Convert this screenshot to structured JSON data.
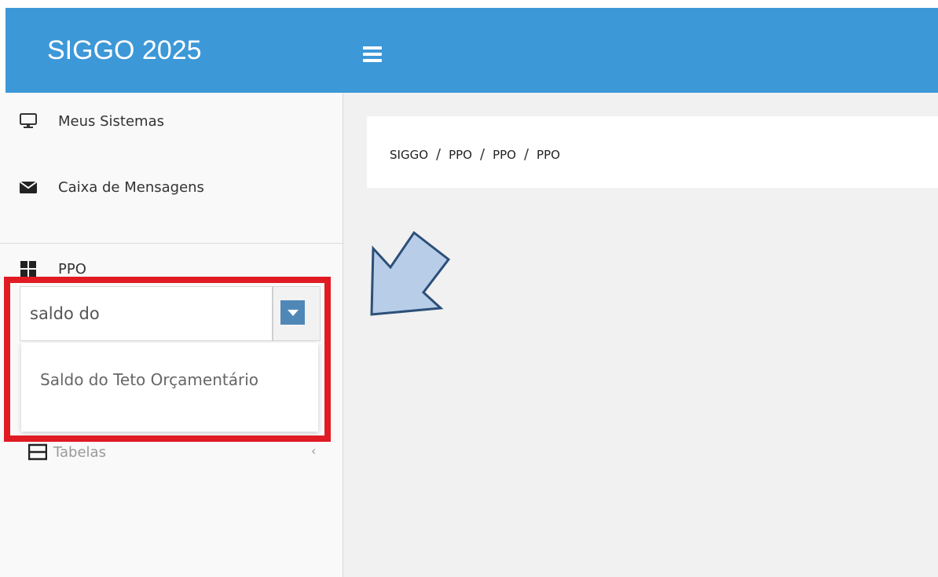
{
  "header": {
    "brand": "SIGGO 2025",
    "menu_icon": "hamburger-icon",
    "background": "#3d98d8"
  },
  "breadcrumb": [
    "SIGGO",
    "PPO",
    "PPO",
    "PPO"
  ],
  "sidebar": {
    "items": [
      {
        "label": "Meus Sistemas",
        "icon": "monitor-icon"
      },
      {
        "label": "Caixa de Mensagens",
        "icon": "envelope-icon"
      },
      {
        "label": "PPO",
        "icon": "grid-icon"
      },
      {
        "label": "Tabelas",
        "icon": "table-icon"
      }
    ],
    "search": {
      "value": "saldo do",
      "results": [
        "Saldo do Teto Orçamentário"
      ]
    }
  },
  "colors": {
    "highlight_box": "#e01b24",
    "arrow_fill": "#b7cde8",
    "arrow_stroke": "#2c4f78",
    "search_button": "#4f88b6"
  }
}
